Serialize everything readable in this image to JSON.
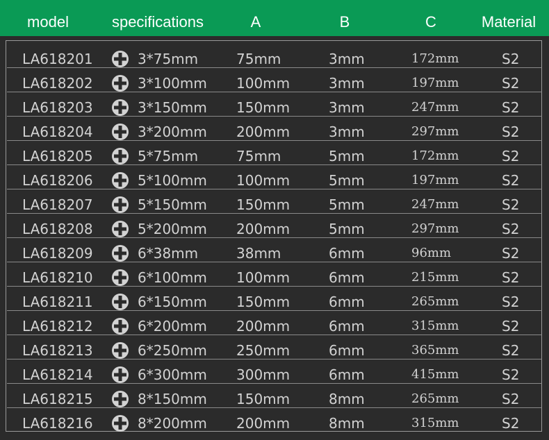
{
  "table": {
    "headers": {
      "model": "model",
      "specifications": "specifications",
      "a": "A",
      "b": "B",
      "c": "C",
      "material": "Material"
    },
    "spec_icon": "phillips-cross-icon",
    "rows": [
      {
        "model": "LA618201",
        "spec": "3*75mm",
        "a": "75mm",
        "b": "3mm",
        "c": "172mm",
        "material": "S2"
      },
      {
        "model": "LA618202",
        "spec": "3*100mm",
        "a": "100mm",
        "b": "3mm",
        "c": "197mm",
        "material": "S2"
      },
      {
        "model": "LA618203",
        "spec": "3*150mm",
        "a": "150mm",
        "b": "3mm",
        "c": "247mm",
        "material": "S2"
      },
      {
        "model": "LA618204",
        "spec": "3*200mm",
        "a": "200mm",
        "b": "3mm",
        "c": "297mm",
        "material": "S2"
      },
      {
        "model": "LA618205",
        "spec": "5*75mm",
        "a": "75mm",
        "b": "5mm",
        "c": "172mm",
        "material": "S2"
      },
      {
        "model": "LA618206",
        "spec": "5*100mm",
        "a": "100mm",
        "b": "5mm",
        "c": "197mm",
        "material": "S2"
      },
      {
        "model": "LA618207",
        "spec": "5*150mm",
        "a": "150mm",
        "b": "5mm",
        "c": "247mm",
        "material": "S2"
      },
      {
        "model": "LA618208",
        "spec": "5*200mm",
        "a": "200mm",
        "b": "5mm",
        "c": "297mm",
        "material": "S2"
      },
      {
        "model": "LA618209",
        "spec": "6*38mm",
        "a": "38mm",
        "b": "6mm",
        "c": "96mm",
        "material": "S2"
      },
      {
        "model": "LA618210",
        "spec": "6*100mm",
        "a": "100mm",
        "b": "6mm",
        "c": "215mm",
        "material": "S2"
      },
      {
        "model": "LA618211",
        "spec": "6*150mm",
        "a": "150mm",
        "b": "6mm",
        "c": "265mm",
        "material": "S2"
      },
      {
        "model": "LA618212",
        "spec": "6*200mm",
        "a": "200mm",
        "b": "6mm",
        "c": "315mm",
        "material": "S2"
      },
      {
        "model": "LA618213",
        "spec": "6*250mm",
        "a": "250mm",
        "b": "6mm",
        "c": "365mm",
        "material": "S2"
      },
      {
        "model": "LA618214",
        "spec": "6*300mm",
        "a": "300mm",
        "b": "6mm",
        "c": "415mm",
        "material": "S2"
      },
      {
        "model": "LA618215",
        "spec": "8*150mm",
        "a": "150mm",
        "b": "8mm",
        "c": "265mm",
        "material": "S2"
      },
      {
        "model": "LA618216",
        "spec": "8*200mm",
        "a": "200mm",
        "b": "8mm",
        "c": "315mm",
        "material": "S2"
      }
    ]
  },
  "colors": {
    "header_bg": "#0a9a55",
    "body_bg": "#2b2b2b",
    "text": "#d2d2d2",
    "divider": "#8a8a8a"
  }
}
